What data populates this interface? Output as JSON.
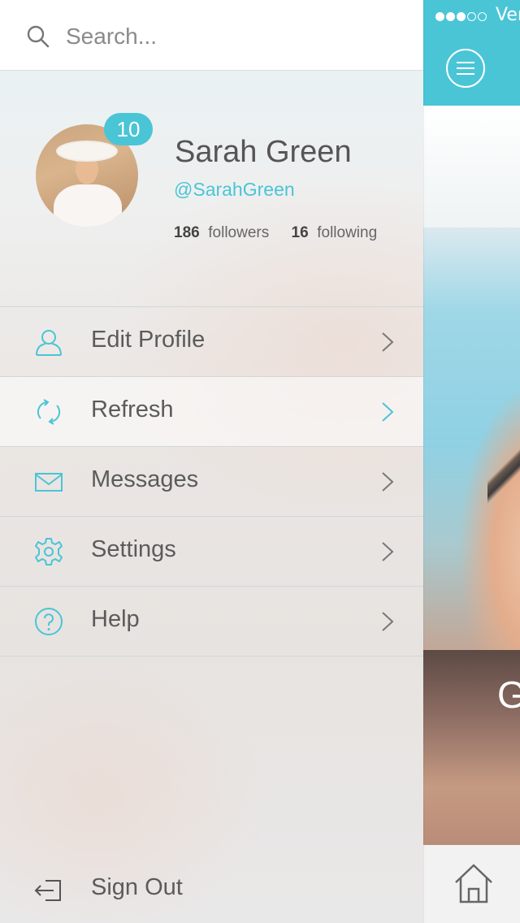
{
  "search": {
    "placeholder": "Search..."
  },
  "profile": {
    "notification_count": "10",
    "name": "Sarah Green",
    "handle": "@SarahGreen",
    "followers_count": "186",
    "followers_label": "followers",
    "following_count": "16",
    "following_label": "following"
  },
  "menu": {
    "items": [
      {
        "label": "Edit Profile",
        "icon": "user-icon"
      },
      {
        "label": "Refresh",
        "icon": "refresh-icon",
        "active": true
      },
      {
        "label": "Messages",
        "icon": "envelope-icon"
      },
      {
        "label": "Settings",
        "icon": "gear-icon"
      },
      {
        "label": "Help",
        "icon": "help-icon"
      }
    ],
    "sign_out": "Sign Out"
  },
  "background_screen": {
    "status_carrier": "Ver",
    "signal_dots": [
      1,
      1,
      1,
      0,
      0
    ],
    "caption_fragment": "G"
  },
  "colors": {
    "accent": "#4ac5d6",
    "text": "#5b5b5b",
    "divider": "#d2d6d8"
  }
}
